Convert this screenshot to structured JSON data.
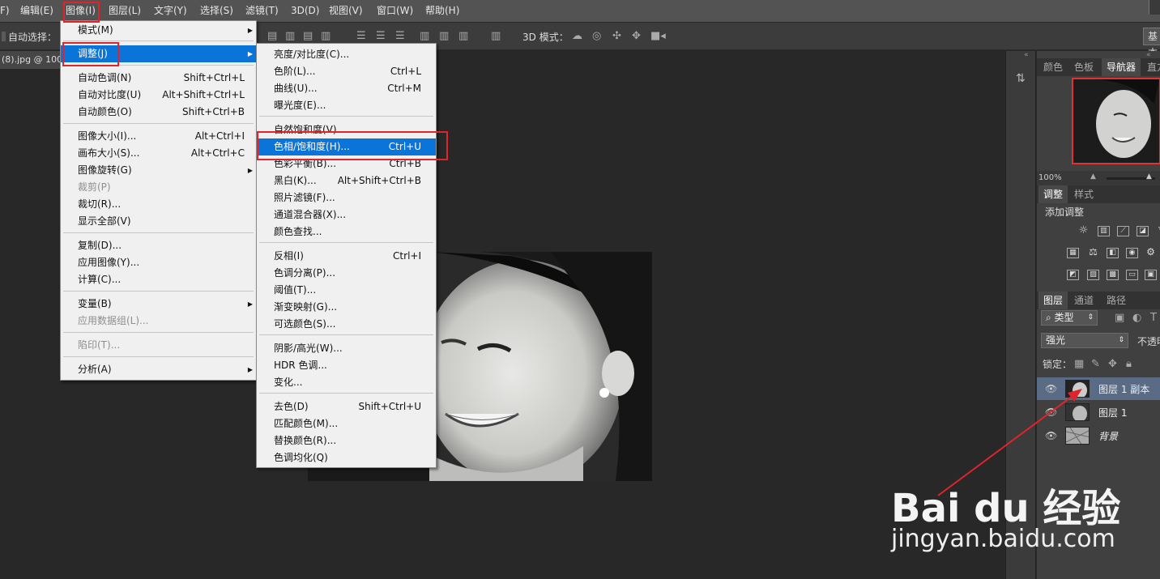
{
  "menubar": {
    "items": [
      "F)",
      "编辑(E)",
      "图像(I)",
      "图层(L)",
      "文字(Y)",
      "选择(S)",
      "滤镜(T)",
      "3D(D)",
      "视图(V)",
      "窗口(W)",
      "帮助(H)"
    ]
  },
  "options": {
    "auto_select": "自动选择：",
    "mode_3d": "3D 模式：",
    "basic": "基本"
  },
  "document": {
    "tab": "(8).jpg @ 100"
  },
  "image_menu": {
    "items": [
      {
        "label": "模式(M)",
        "shortcut": "",
        "submenu": true,
        "disabled": false
      },
      {
        "label": "调整(J)",
        "shortcut": "",
        "submenu": true,
        "disabled": false,
        "highlight": true
      },
      {
        "label": "自动色调(N)",
        "shortcut": "Shift+Ctrl+L",
        "disabled": false
      },
      {
        "label": "自动对比度(U)",
        "shortcut": "Alt+Shift+Ctrl+L",
        "disabled": false
      },
      {
        "label": "自动颜色(O)",
        "shortcut": "Shift+Ctrl+B",
        "disabled": false
      },
      {
        "label": "图像大小(I)...",
        "shortcut": "Alt+Ctrl+I",
        "disabled": false
      },
      {
        "label": "画布大小(S)...",
        "shortcut": "Alt+Ctrl+C",
        "disabled": false
      },
      {
        "label": "图像旋转(G)",
        "shortcut": "",
        "submenu": true,
        "disabled": false
      },
      {
        "label": "裁剪(P)",
        "shortcut": "",
        "disabled": true
      },
      {
        "label": "裁切(R)...",
        "shortcut": "",
        "disabled": false
      },
      {
        "label": "显示全部(V)",
        "shortcut": "",
        "disabled": false
      },
      {
        "label": "复制(D)...",
        "shortcut": "",
        "disabled": false
      },
      {
        "label": "应用图像(Y)...",
        "shortcut": "",
        "disabled": false
      },
      {
        "label": "计算(C)...",
        "shortcut": "",
        "disabled": false
      },
      {
        "label": "变量(B)",
        "shortcut": "",
        "submenu": true,
        "disabled": false
      },
      {
        "label": "应用数据组(L)...",
        "shortcut": "",
        "disabled": true
      },
      {
        "label": "陷印(T)...",
        "shortcut": "",
        "disabled": true
      },
      {
        "label": "分析(A)",
        "shortcut": "",
        "submenu": true,
        "disabled": false
      }
    ]
  },
  "adjust_menu": {
    "items": [
      {
        "label": "亮度/对比度(C)...",
        "shortcut": ""
      },
      {
        "label": "色阶(L)...",
        "shortcut": "Ctrl+L"
      },
      {
        "label": "曲线(U)...",
        "shortcut": "Ctrl+M"
      },
      {
        "label": "曝光度(E)...",
        "shortcut": ""
      },
      {
        "label": "自然饱和度(V)...",
        "shortcut": ""
      },
      {
        "label": "色相/饱和度(H)...",
        "shortcut": "Ctrl+U",
        "highlight": true
      },
      {
        "label": "色彩平衡(B)...",
        "shortcut": "Ctrl+B"
      },
      {
        "label": "黑白(K)...",
        "shortcut": "Alt+Shift+Ctrl+B"
      },
      {
        "label": "照片滤镜(F)...",
        "shortcut": ""
      },
      {
        "label": "通道混合器(X)...",
        "shortcut": ""
      },
      {
        "label": "颜色查找...",
        "shortcut": ""
      },
      {
        "label": "反相(I)",
        "shortcut": "Ctrl+I"
      },
      {
        "label": "色调分离(P)...",
        "shortcut": ""
      },
      {
        "label": "阈值(T)...",
        "shortcut": ""
      },
      {
        "label": "渐变映射(G)...",
        "shortcut": ""
      },
      {
        "label": "可选颜色(S)...",
        "shortcut": ""
      },
      {
        "label": "阴影/高光(W)...",
        "shortcut": ""
      },
      {
        "label": "HDR 色调...",
        "shortcut": ""
      },
      {
        "label": "变化...",
        "shortcut": ""
      },
      {
        "label": "去色(D)",
        "shortcut": "Shift+Ctrl+U"
      },
      {
        "label": "匹配颜色(M)...",
        "shortcut": ""
      },
      {
        "label": "替换颜色(R)...",
        "shortcut": ""
      },
      {
        "label": "色调均化(Q)",
        "shortcut": ""
      }
    ]
  },
  "panels": {
    "top_tabs": [
      "颜色",
      "色板",
      "导航器",
      "直方"
    ],
    "zoom": "100%",
    "adj_tabs": [
      "调整",
      "样式"
    ],
    "adj_title": "添加调整",
    "layer_tabs": [
      "图层",
      "通道",
      "路径"
    ],
    "kind_filter": "类型",
    "blend_mode": "强光",
    "opacity_label": "不透明",
    "lock_label": "锁定：",
    "layers": [
      "图层 1 副本",
      "图层 1",
      "背景"
    ]
  },
  "watermark": {
    "brand": "Bai du 经验",
    "url": "jingyan.baidu.com"
  },
  "colors": {
    "highlight": "#0a74d9",
    "annotation": "#e0242c",
    "selected_layer": "#5a6b85"
  }
}
